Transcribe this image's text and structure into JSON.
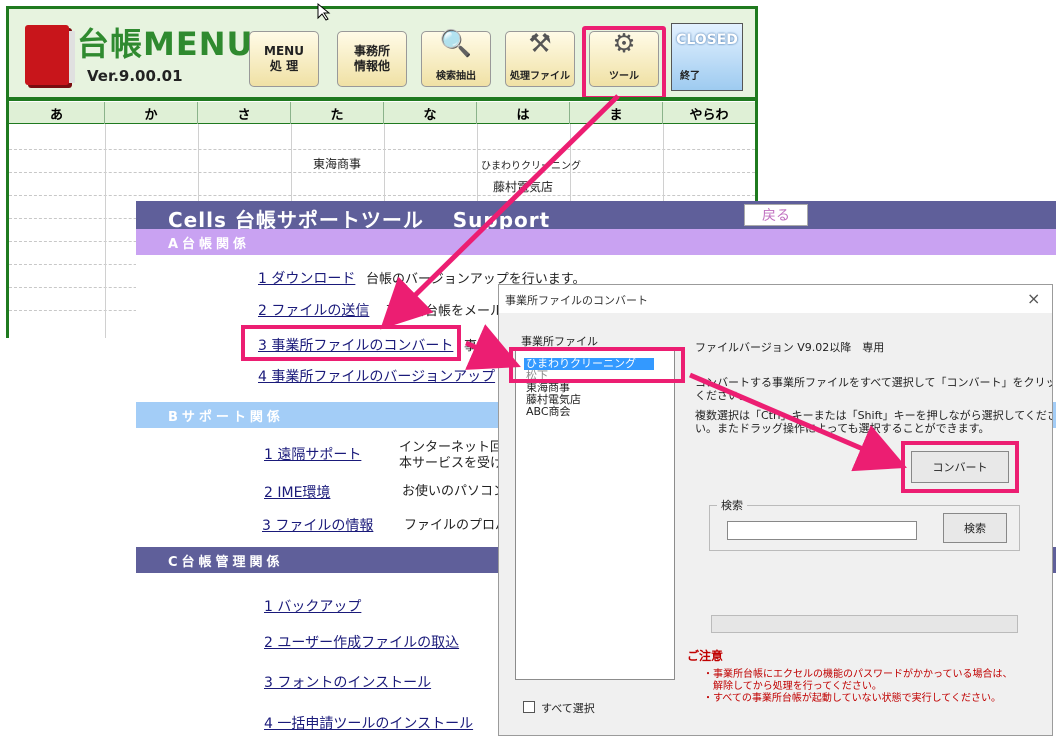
{
  "menu": {
    "title": "台帳MENU",
    "version": "Ver.9.00.01",
    "toolbar": [
      {
        "label": "MENU\n処 理",
        "icon": "menu-icon"
      },
      {
        "label": "事務所\n情報他",
        "icon": "info-icon"
      },
      {
        "label": "検索抽出",
        "icon": "magnifier-question-icon"
      },
      {
        "label": "処理ファイル",
        "icon": "worker-file-icon"
      },
      {
        "label": "ツール",
        "icon": "tools-worker-icon"
      }
    ],
    "closed_label": "CLOSED",
    "closed_sub": "終了",
    "kana": [
      "あ",
      "か",
      "さ",
      "た",
      "な",
      "は",
      "ま",
      "やらわ"
    ],
    "cells": {
      "ta": "東海商事",
      "ha1": "ひまわりクリーニング",
      "ha2": "藤村電気店"
    }
  },
  "support": {
    "title": "Cells 台帳サポートツール　 Support",
    "back_label": "戻る",
    "section_a": "A台帳関係",
    "section_b": "Bサポート関係",
    "section_c": "C台帳管理関係",
    "a_items": [
      {
        "label": "1 ダウンロード",
        "desc": "台帳のバージョンアップを行います。"
      },
      {
        "label": "2 ファイルの送信",
        "desc": "事務所台帳をメールで"
      },
      {
        "label": "3 事業所ファイルのコンバート",
        "desc": "事業所"
      },
      {
        "label": "4 事業所ファイルのバージョンアップ",
        "desc": ""
      }
    ],
    "b_items": [
      {
        "label": "1 遠隔サポート",
        "desc": "インターネット回線",
        "desc2": "本サービスを受ける"
      },
      {
        "label": "2 IME環境",
        "desc": "お使いのパソコン",
        "desc2": ""
      },
      {
        "label": "3 ファイルの情報",
        "desc": "ファイルのプロパテ",
        "desc2": ""
      }
    ],
    "c_items": [
      {
        "label": "1 バックアップ"
      },
      {
        "label": "2 ユーザー作成ファイルの取込"
      },
      {
        "label": "3 フォントのインストール"
      },
      {
        "label": "4 一括申請ツールのインストール"
      }
    ]
  },
  "dialog": {
    "title": "事業所ファイルのコンバート",
    "close": "×",
    "list_label": "事業所ファイル",
    "files": [
      "ひまわりクリーニング",
      "松下",
      "東海商事",
      "藤村電気店",
      "ABC商会"
    ],
    "version_note": "ファイルバージョン V9.02以降　専用",
    "instruction1": "コンバートする事業所ファイルをすべて選択して「コンバート」をクリックして",
    "instruction1b": "ください。",
    "instruction2": "複数選択は「Ctrl」キーまたは「Shift」キーを押しながら選択してくださ",
    "instruction2b": "い。またドラッグ操作によっても選択することができます。",
    "convert_button": "コンバート",
    "search_group": "検索",
    "search_button": "検索",
    "select_all": "すべて選択",
    "caution_title": "ご注意",
    "caution1": "・事業所台帳にエクセルの機能のパスワードがかかっている場合は、",
    "caution1b": "解除してから処理を行ってください。",
    "caution2": "・すべての事業所台帳が起動していない状態で実行してください。"
  },
  "colors": {
    "menu_green": "#1f7a1f",
    "highlight_pink": "#ec1e72",
    "support_header": "#5f5f9a",
    "section_a": "#c9a2f2",
    "section_b": "#a3cdf7",
    "caution_red": "#c00000"
  }
}
